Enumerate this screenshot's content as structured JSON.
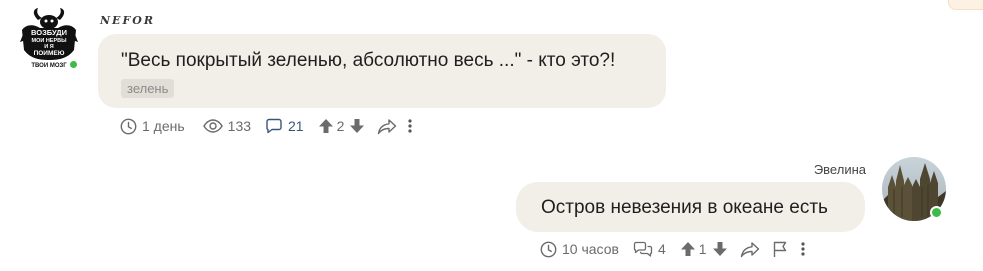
{
  "colors": {
    "bubble": "#f2efe9",
    "tag_bg": "#e2ded7",
    "online": "#3dbb4a",
    "reply_link": "#37567a",
    "meta_text": "#6b6b6b"
  },
  "messages": [
    {
      "author": "NEFOR",
      "avatar_icon": "demon-text-avatar",
      "avatar_text": [
        "ВОЗБУДИ",
        "МОИ НЕРВЫ",
        "И Я",
        "ПОИМЕЮ",
        "ТВОИ МОЗГ"
      ],
      "online": true,
      "text": "\"Весь покрытый зеленью, абсолютно весь ...\" - кто это?!",
      "tag": "зелень",
      "time": "1 день",
      "views": "133",
      "replies": "21",
      "score": "2"
    },
    {
      "author": "Эвелина",
      "avatar_icon": "gothic-cathedral-photo",
      "online": true,
      "text": "Остров невезения в океане есть",
      "time": "10 часов",
      "replies": "4",
      "score": "1"
    }
  ]
}
